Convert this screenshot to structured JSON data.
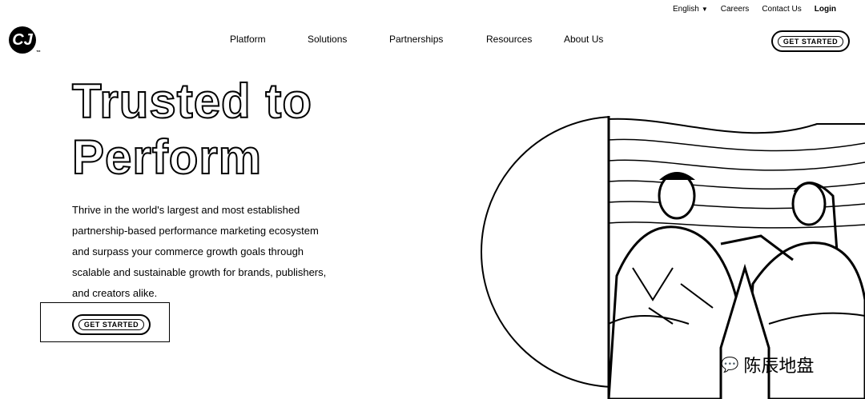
{
  "topbar": {
    "language": "English",
    "careers": "Careers",
    "contact": "Contact Us",
    "login": "Login"
  },
  "logo": {
    "mark": "CJ",
    "tm": "™"
  },
  "nav": {
    "platform": "Platform",
    "solutions": "Solutions",
    "partnerships": "Partnerships",
    "resources": "Resources",
    "about": "About Us"
  },
  "header_cta": "GET STARTED",
  "hero": {
    "line1": "Trusted to",
    "line2": "Perform",
    "description": "Thrive in the world's largest and most established partnership-based performance marketing ecosystem and surpass your commerce growth goals through scalable and sustainable growth for brands, publishers, and creators alike.",
    "cta": "GET STARTED"
  },
  "watermark": "陈辰地盘",
  "icons": {
    "language_caret": "caret-down-icon",
    "watermark_logo": "wechat-icon"
  }
}
